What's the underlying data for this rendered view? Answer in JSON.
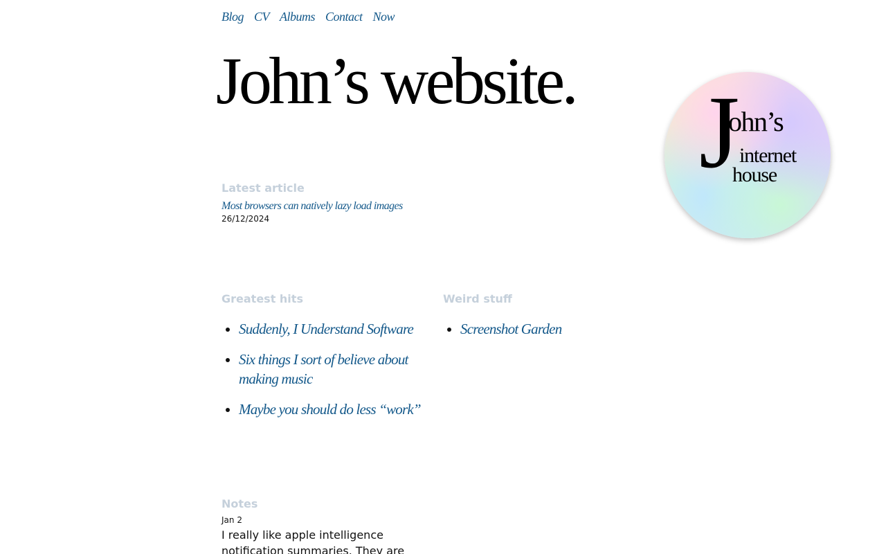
{
  "nav": {
    "items": [
      {
        "label": "Blog"
      },
      {
        "label": "CV"
      },
      {
        "label": "Albums"
      },
      {
        "label": "Contact"
      },
      {
        "label": "Now"
      }
    ]
  },
  "site_title": "John’s website.",
  "logo": {
    "j": "J",
    "ohns": "ohn’s",
    "internet": "internet",
    "house": "house"
  },
  "latest_article": {
    "heading": "Latest article",
    "title": "Most browsers can natively lazy load images",
    "date": "26/12/2024"
  },
  "greatest_hits": {
    "heading": "Greatest hits",
    "items": [
      {
        "label": "Suddenly, I Understand Software"
      },
      {
        "label": "Six things I sort of believe about making music"
      },
      {
        "label": "Maybe you should do less “work”"
      }
    ]
  },
  "weird_stuff": {
    "heading": "Weird stuff",
    "items": [
      {
        "label": "Screenshot Garden"
      }
    ]
  },
  "notes": {
    "heading": "Notes",
    "date": "Jan 2",
    "text": "I really like apple intelligence notification summaries. They are"
  },
  "colors": {
    "link": "#13588a",
    "section_heading": "#c5d0db",
    "text": "#111111"
  }
}
